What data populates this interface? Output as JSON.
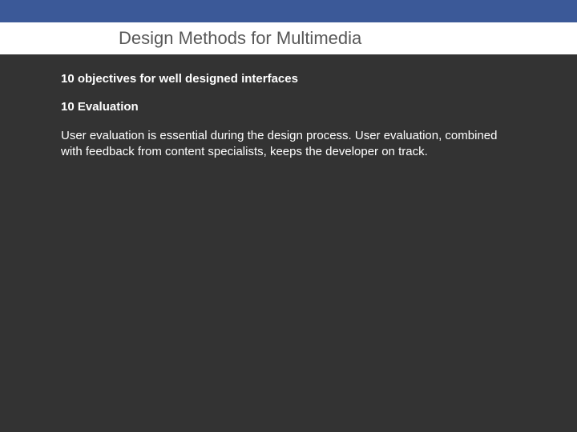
{
  "header": {
    "title": "Design Methods for Multimedia"
  },
  "content": {
    "heading1": "10 objectives for well designed interfaces",
    "heading2": "10 Evaluation",
    "body": "User evaluation is essential during the design process. User evaluation, combined with feedback from content specialists, keeps the developer on track."
  }
}
